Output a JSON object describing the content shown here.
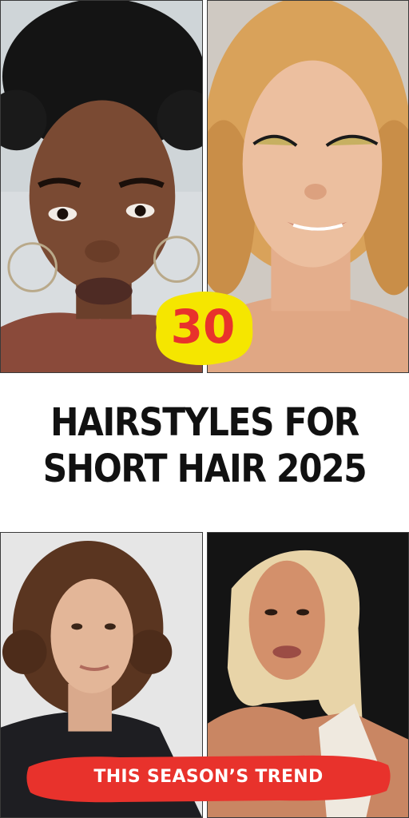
{
  "title": {
    "line1": "HAIRSTYLES FOR",
    "line2": "SHORT HAIR 2025"
  },
  "badge": {
    "number": "30",
    "color": "#f5e600",
    "text_color": "#e8322c"
  },
  "banner": {
    "text": "THIS SEASON’S TREND",
    "color": "#e8322c"
  },
  "photos": [
    {
      "name": "curly-afro-updo",
      "position": "top-left"
    },
    {
      "name": "wavy-blonde-bob",
      "position": "top-right"
    },
    {
      "name": "curly-brunette-bob",
      "position": "bottom-left"
    },
    {
      "name": "sleek-platinum-bob",
      "position": "bottom-right"
    }
  ]
}
